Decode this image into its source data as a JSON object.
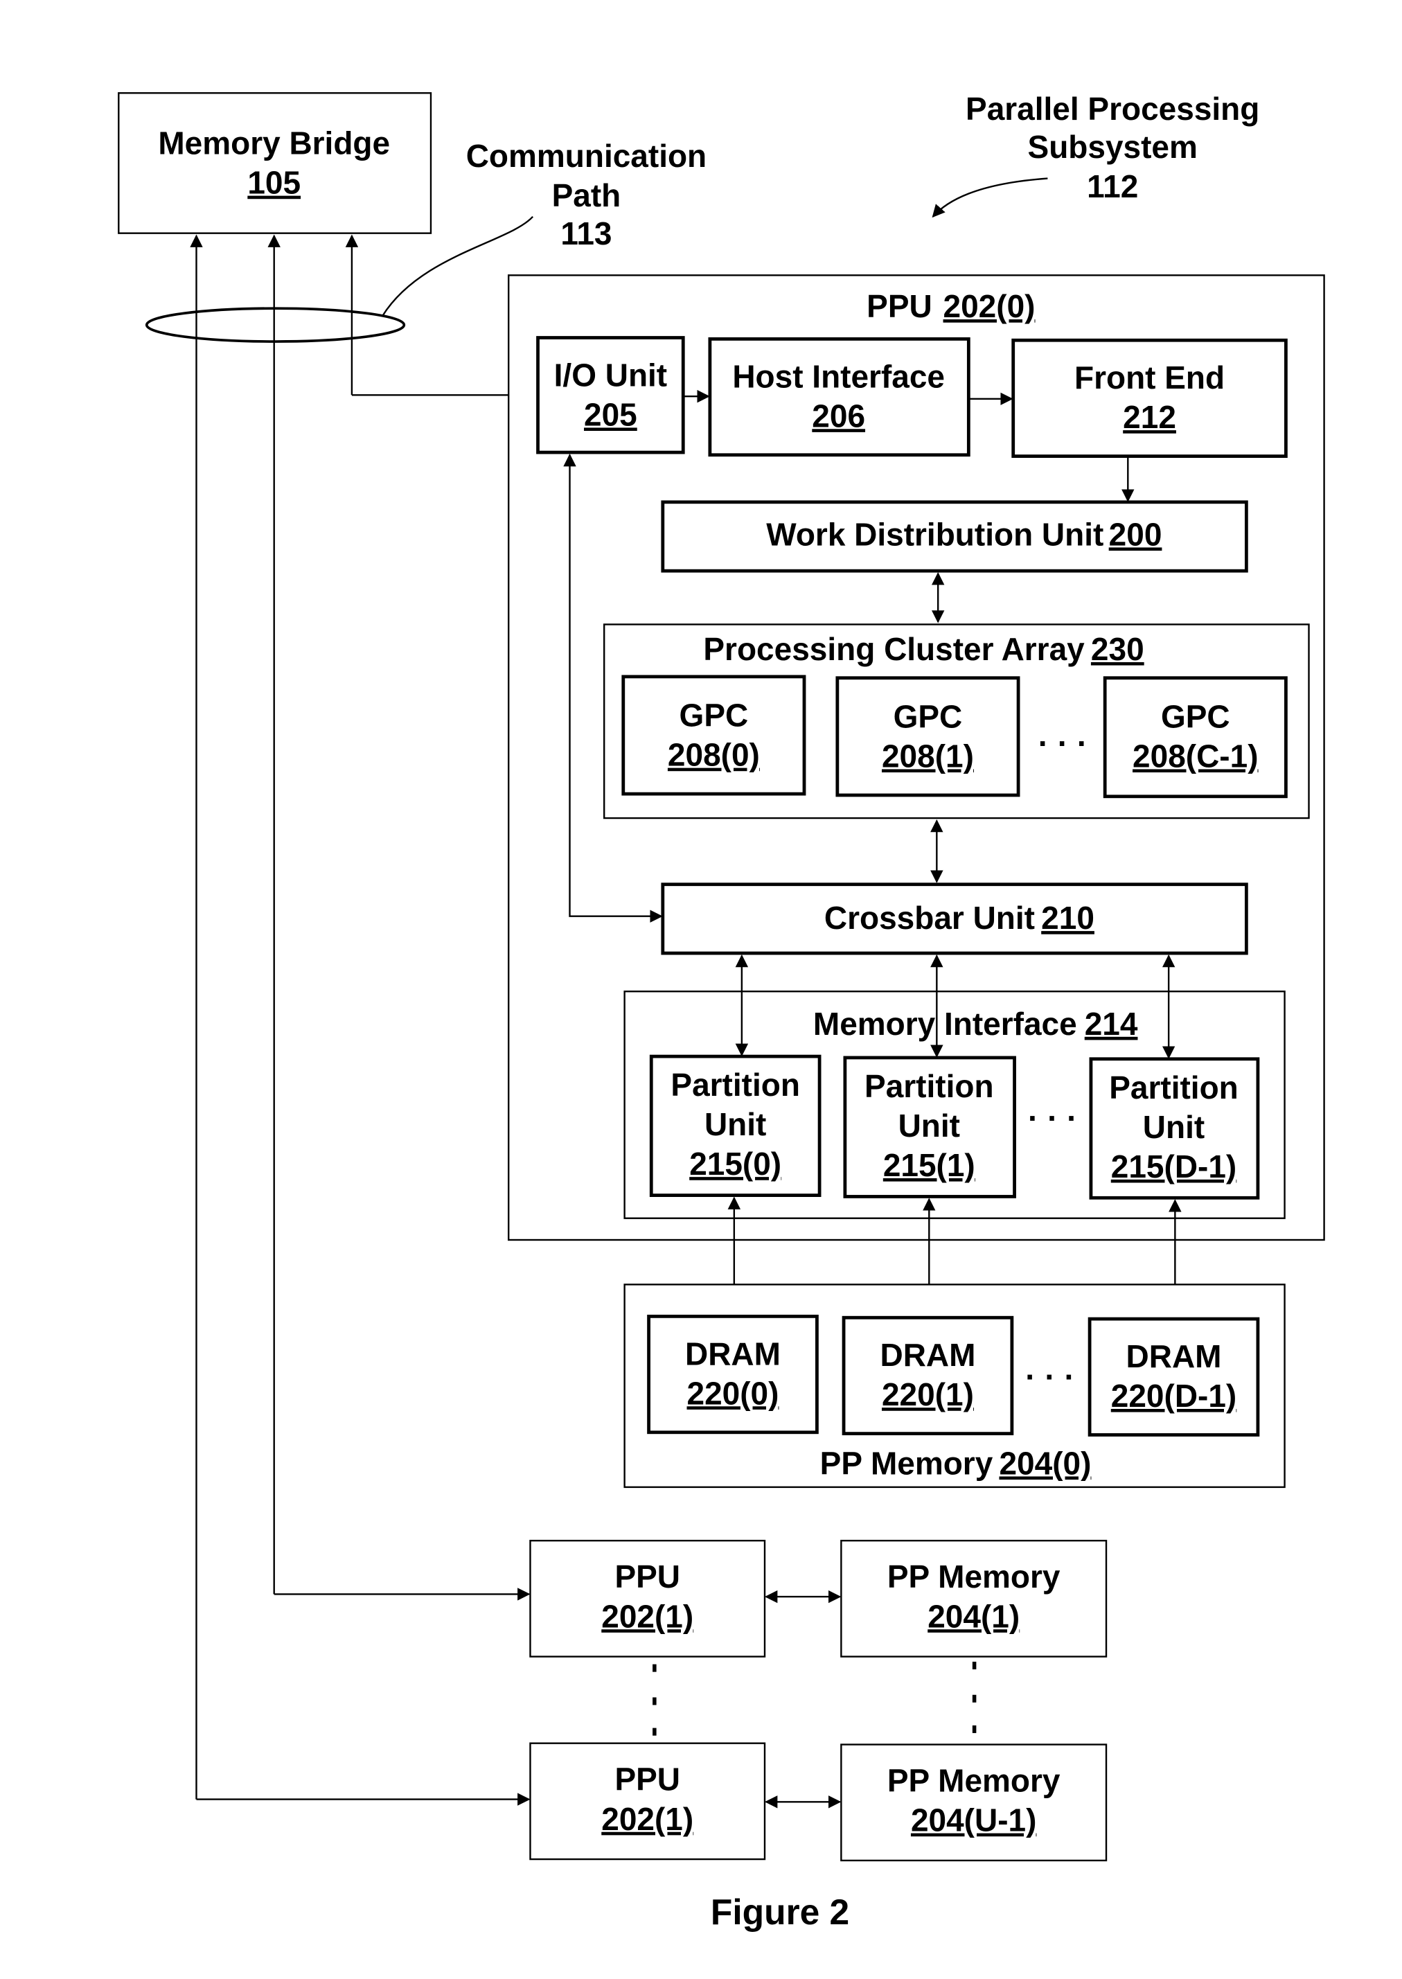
{
  "figure_caption": "Figure 2",
  "callouts": {
    "communication_path": {
      "lines": [
        "Communication",
        "Path",
        "113"
      ]
    },
    "parallel_processing_subsystem": {
      "lines": [
        "Parallel Processing",
        "Subsystem",
        "112"
      ]
    }
  },
  "memory_bridge": {
    "label": "Memory Bridge",
    "ref": "105"
  },
  "ppu0": {
    "label": "PPU",
    "ref": "202(0)",
    "io_unit": {
      "label": "I/O Unit",
      "ref": "205"
    },
    "host_interface": {
      "label": "Host Interface",
      "ref": "206"
    },
    "front_end": {
      "label": "Front End",
      "ref": "212"
    },
    "work_distribution_unit": {
      "label": "Work Distribution Unit",
      "ref": "200"
    },
    "processing_cluster_array": {
      "label": "Processing Cluster Array",
      "ref": "230",
      "gpcs": [
        {
          "label": "GPC",
          "ref": "208(0)"
        },
        {
          "label": "GPC",
          "ref": "208(1)"
        },
        {
          "label": "GPC",
          "ref": "208(C-1)"
        }
      ],
      "ellipsis": "· · ·"
    },
    "crossbar_unit": {
      "label": "Crossbar Unit",
      "ref": "210"
    },
    "memory_interface": {
      "label": "Memory Interface",
      "ref": "214",
      "partitions": [
        {
          "label1": "Partition",
          "label2": "Unit",
          "ref": "215(0)"
        },
        {
          "label1": "Partition",
          "label2": "Unit",
          "ref": "215(1)"
        },
        {
          "label1": "Partition",
          "label2": "Unit",
          "ref": "215(D-1)"
        }
      ],
      "ellipsis": "· · ·"
    }
  },
  "pp_memory0": {
    "label": "PP Memory",
    "ref": "204(0)",
    "drams": [
      {
        "label": "DRAM",
        "ref": "220(0)"
      },
      {
        "label": "DRAM",
        "ref": "220(1)"
      },
      {
        "label": "DRAM",
        "ref": "220(D-1)"
      }
    ],
    "ellipsis": "· · ·"
  },
  "other_ppus": [
    {
      "ppu_label": "PPU",
      "ppu_ref": "202(1)",
      "mem_label": "PP Memory",
      "mem_ref": "204(1)"
    },
    {
      "ppu_label": "PPU",
      "ppu_ref": "202(1)",
      "mem_label": "PP Memory",
      "mem_ref": "204(U-1)"
    }
  ]
}
